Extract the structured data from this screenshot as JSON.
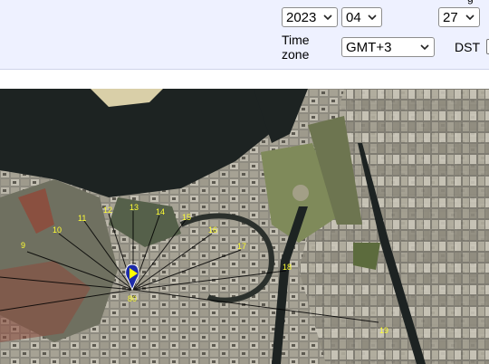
{
  "toolbar": {
    "year_select": {
      "value": "2023"
    },
    "month_select": {
      "value": "04"
    },
    "day_select": {
      "value": "27"
    },
    "day_label_partial": "g",
    "timezone_label_line1": "Time",
    "timezone_label_line2": "zone",
    "timezone_select": {
      "value": "GMT+3"
    },
    "dst_label": "DST"
  },
  "map": {
    "center_label": "80",
    "hour_labels": [
      "9",
      "10",
      "11",
      "12",
      "13",
      "14",
      "15",
      "16",
      "17",
      "18",
      "19"
    ],
    "colors": {
      "hour_label": "#ffff33",
      "marker": "#1d2ba8",
      "marker_arrow": "#ffff00",
      "water": "#1d2322"
    }
  }
}
